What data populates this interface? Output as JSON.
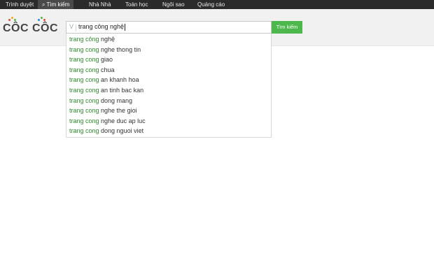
{
  "topnav": {
    "items": [
      {
        "label": "Trình duyệt",
        "active": false
      },
      {
        "label": "Tìm kiếm",
        "active": true,
        "icon": "search-icon"
      },
      {
        "label": "Nhà Nhà",
        "active": false
      },
      {
        "label": "Toán học",
        "active": false
      },
      {
        "label": "Ngôi sao",
        "active": false
      },
      {
        "label": "Quảng cáo",
        "active": false
      }
    ]
  },
  "logo": {
    "word1": "CÔC",
    "word2": "CÔC",
    "colors": [
      "#e8492b",
      "#f7a81b",
      "#4cb84c",
      "#1e88e5"
    ]
  },
  "search": {
    "icon": "v-icon",
    "icon_glyph": "V",
    "value": "trang công nghệ",
    "button_label": "Tìm kiếm",
    "button_color": "#4cb84c"
  },
  "suggestions": [
    {
      "highlight": "trang công",
      "rest": " nghệ"
    },
    {
      "highlight": "trang cong",
      "rest": " nghe thong tin"
    },
    {
      "highlight": "trang cong",
      "rest": " giao"
    },
    {
      "highlight": "trang cong",
      "rest": " chua"
    },
    {
      "highlight": "trang cong",
      "rest": " an khanh hoa"
    },
    {
      "highlight": "trang cong",
      "rest": " an tinh bac kan"
    },
    {
      "highlight": "trang cong",
      "rest": " dong mang"
    },
    {
      "highlight": "trang cong",
      "rest": " nghe the gioi"
    },
    {
      "highlight": "trang cong",
      "rest": " nghe duc ap luc"
    },
    {
      "highlight": "trang cong",
      "rest": " dong nguoi viet"
    }
  ]
}
